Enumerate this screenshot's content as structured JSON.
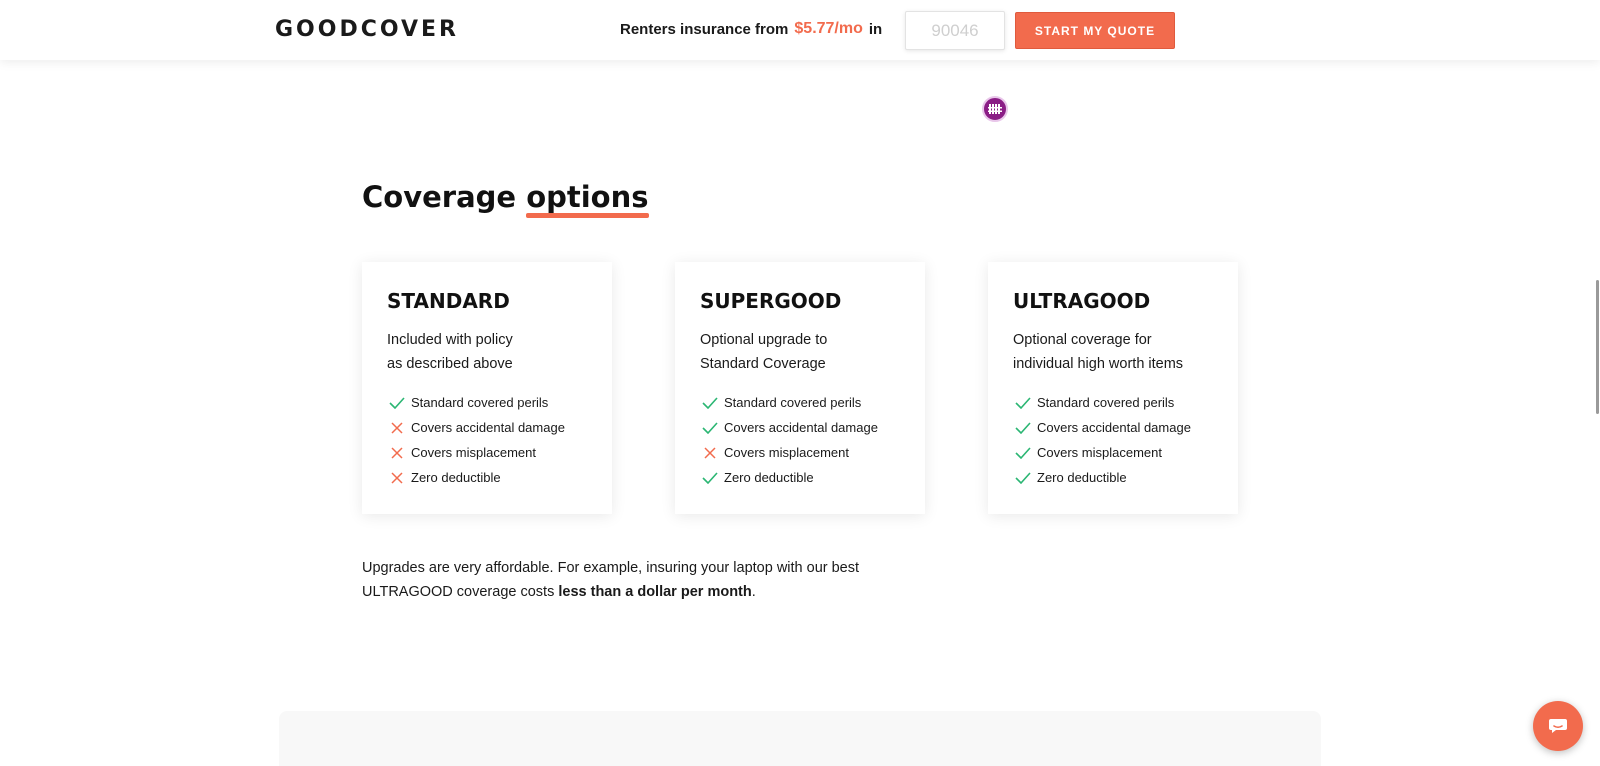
{
  "header": {
    "logo": "GOODCOVER",
    "promo_prefix": "Renters insurance from",
    "promo_price": "$5.77/mo",
    "promo_in": "in",
    "zip_placeholder": "90046",
    "quote_button": "START MY QUOTE"
  },
  "section": {
    "title_main": "Coverage",
    "title_accent": "options"
  },
  "cards": [
    {
      "title": "STANDARD",
      "desc_line1": "Included with policy",
      "desc_line2": "as described above",
      "features": [
        {
          "label": "Standard covered perils",
          "included": true
        },
        {
          "label": "Covers accidental damage",
          "included": false
        },
        {
          "label": "Covers misplacement",
          "included": false
        },
        {
          "label": "Zero deductible",
          "included": false
        }
      ]
    },
    {
      "title": "SUPERGOOD",
      "desc_line1": "Optional upgrade to",
      "desc_line2": "Standard Coverage",
      "features": [
        {
          "label": "Standard covered perils",
          "included": true
        },
        {
          "label": "Covers accidental damage",
          "included": true
        },
        {
          "label": "Covers misplacement",
          "included": false
        },
        {
          "label": "Zero deductible",
          "included": true
        }
      ]
    },
    {
      "title": "ULTRAGOOD",
      "desc_line1": "Optional coverage for",
      "desc_line2": "individual high worth items",
      "features": [
        {
          "label": "Standard covered perils",
          "included": true
        },
        {
          "label": "Covers accidental damage",
          "included": true
        },
        {
          "label": "Covers misplacement",
          "included": true
        },
        {
          "label": "Zero deductible",
          "included": true
        }
      ]
    }
  ],
  "note": {
    "line1": "Upgrades are very affordable. For example, insuring your laptop with our best",
    "line2_prefix": "ULTRAGOOD coverage costs ",
    "line2_bold": "less than a dollar per month",
    "line2_suffix": "."
  },
  "colors": {
    "accent": "#f26b4d",
    "check": "#2bb673",
    "cross": "#f26b4d",
    "badge": "#8b1d86"
  },
  "icons": {
    "included": "check-icon",
    "excluded": "cross-icon",
    "chat": "chat-icon",
    "badge": "fence-icon"
  }
}
